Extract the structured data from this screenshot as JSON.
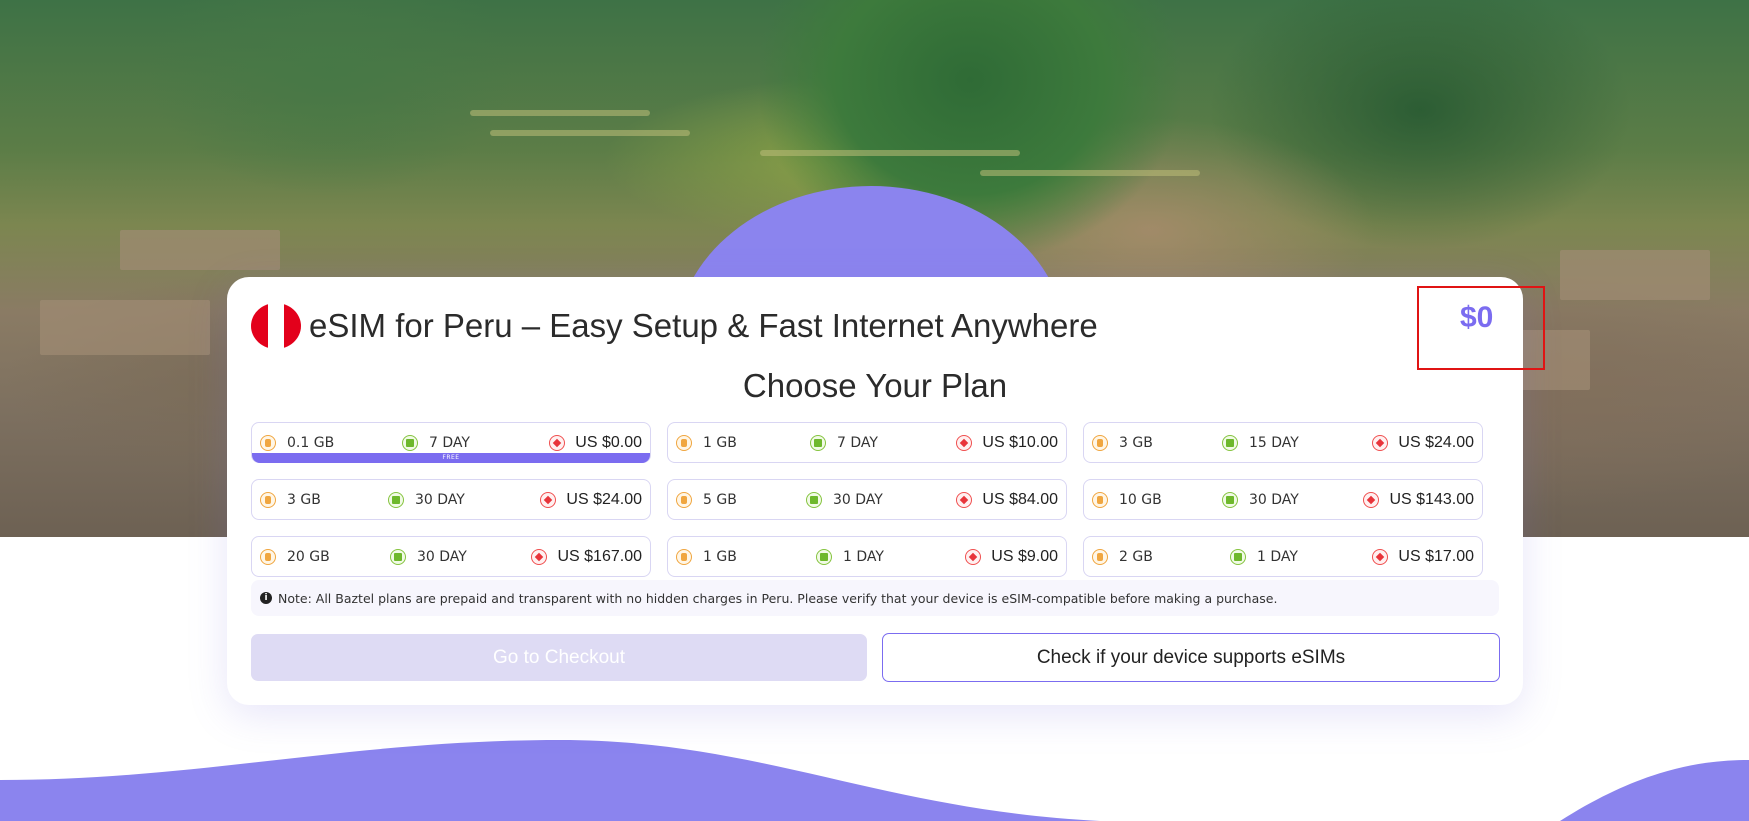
{
  "header": {
    "title": "eSIM for Peru – Easy Setup & Fast Internet Anywhere",
    "total_price": "$0",
    "flag_icon": "peru-flag-icon"
  },
  "plans_section": {
    "heading": "Choose Your Plan",
    "plans": [
      {
        "data": "0.1 GB",
        "days": "7 DAY",
        "price": "US $0.00",
        "badge": "FREE",
        "selected": true
      },
      {
        "data": "1 GB",
        "days": "7 DAY",
        "price": "US $10.00"
      },
      {
        "data": "3 GB",
        "days": "15 DAY",
        "price": "US $24.00"
      },
      {
        "data": "3 GB",
        "days": "30 DAY",
        "price": "US $24.00"
      },
      {
        "data": "5 GB",
        "days": "30 DAY",
        "price": "US $84.00"
      },
      {
        "data": "10 GB",
        "days": "30 DAY",
        "price": "US $143.00"
      },
      {
        "data": "20 GB",
        "days": "30 DAY",
        "price": "US $167.00"
      },
      {
        "data": "1 GB",
        "days": "1 DAY",
        "price": "US $9.00"
      },
      {
        "data": "2 GB",
        "days": "1 DAY",
        "price": "US $17.00"
      }
    ]
  },
  "note": {
    "icon": "info-icon",
    "text": "Note: All Baztel plans are prepaid and transparent with no hidden charges in Peru. Please verify that your device is eSIM-compatible before making a purchase."
  },
  "actions": {
    "checkout_label": "Go to Checkout",
    "checkout_disabled": true,
    "check_device_label": "Check if your device supports eSIMs"
  },
  "colors": {
    "accent": "#7b6cf0",
    "highlight_box": "#e01414",
    "data_icon": "#f0a640",
    "days_icon": "#6eb82c",
    "price_icon": "#e8343a"
  }
}
